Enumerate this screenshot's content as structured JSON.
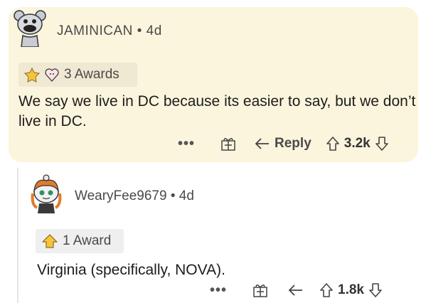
{
  "comment1": {
    "username": "JAMINICAN",
    "separator": "•",
    "age": "4d",
    "awards_label": "3 Awards",
    "body": "We say we live in DC because its easier to say, but we don’t live in DC.",
    "actions": {
      "more": "•••",
      "reply_label": "Reply",
      "score": "3.2k"
    }
  },
  "comment2": {
    "username": "WearyFee9679",
    "separator": "•",
    "age": "4d",
    "awards_label": "1 Award",
    "body": "Virginia (specifically, NOVA).",
    "actions": {
      "more": "•••",
      "score": "1.8k"
    }
  },
  "colors": {
    "comment_highlight": "#fbf5dd",
    "text": "#1c1c1c",
    "muted": "#4a4a4a"
  },
  "icons": [
    "snoo-avatar-icon",
    "award-icon",
    "gift-icon",
    "reply-arrow-icon",
    "upvote-icon",
    "downvote-icon"
  ]
}
